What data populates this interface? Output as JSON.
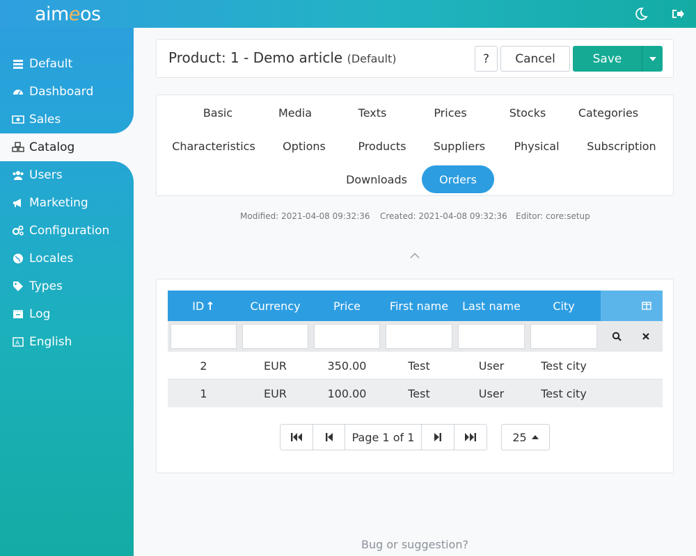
{
  "brand": {
    "logo_pre": "aim",
    "logo_e": "e",
    "logo_post": "os"
  },
  "topbar": {
    "theme_icon": "moon-icon",
    "logout_icon": "logout-icon"
  },
  "sidebar": {
    "items": [
      {
        "label": "Default",
        "icon": "sites-icon"
      },
      {
        "label": "Dashboard",
        "icon": "dashboard-icon"
      },
      {
        "label": "Sales",
        "icon": "money-icon"
      },
      {
        "label": "Catalog",
        "icon": "cubes-icon",
        "active": true
      },
      {
        "label": "Users",
        "icon": "users-icon"
      },
      {
        "label": "Marketing",
        "icon": "megaphone-icon"
      },
      {
        "label": "Configuration",
        "icon": "gears-icon"
      },
      {
        "label": "Locales",
        "icon": "globe-icon"
      },
      {
        "label": "Types",
        "icon": "tag-icon"
      },
      {
        "label": "Log",
        "icon": "log-icon"
      },
      {
        "label": "English",
        "icon": "language-icon"
      }
    ]
  },
  "header": {
    "title": "Product: 1 - Demo article",
    "subtitle": "(Default)",
    "help_label": "?",
    "cancel_label": "Cancel",
    "save_label": "Save"
  },
  "tabs": [
    {
      "label": "Basic"
    },
    {
      "label": "Media"
    },
    {
      "label": "Texts"
    },
    {
      "label": "Prices"
    },
    {
      "label": "Stocks"
    },
    {
      "label": "Categories"
    },
    {
      "label": "Characteristics"
    },
    {
      "label": "Options"
    },
    {
      "label": "Products"
    },
    {
      "label": "Suppliers"
    },
    {
      "label": "Physical"
    },
    {
      "label": "Subscription"
    },
    {
      "label": "Downloads"
    },
    {
      "label": "Orders",
      "active": true
    }
  ],
  "meta": {
    "modified": "Modified: 2021-04-08 09:32:36",
    "created": "Created: 2021-04-08 09:32:36",
    "editor": "Editor: core:setup"
  },
  "orders_table": {
    "columns": [
      "ID",
      "Currency",
      "Price",
      "First name",
      "Last name",
      "City"
    ],
    "sort_indicator": "↑",
    "rows": [
      [
        "2",
        "EUR",
        "350.00",
        "Test",
        "User",
        "Test city"
      ],
      [
        "1",
        "EUR",
        "100.00",
        "Test",
        "User",
        "Test city"
      ]
    ]
  },
  "pagination": {
    "page_label": "Page 1 of 1",
    "page_size": "25"
  },
  "colors": {
    "primary": "#2d9de2",
    "save": "#14aa94"
  },
  "footer": {
    "link": "Bug or suggestion?"
  }
}
